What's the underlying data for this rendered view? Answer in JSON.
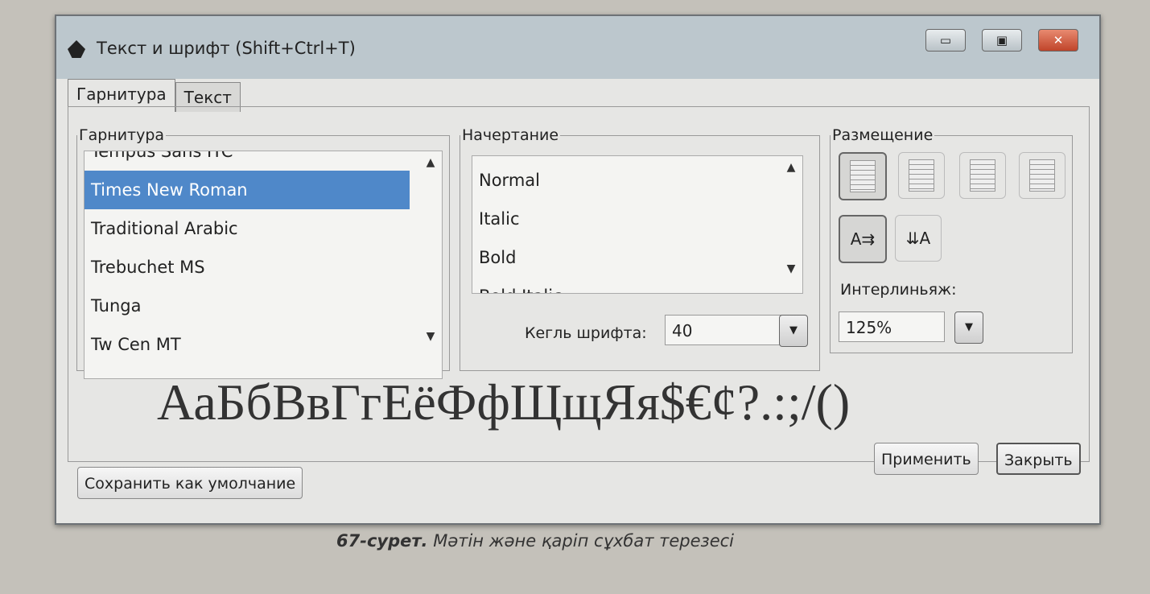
{
  "window": {
    "title": "Текст и шрифт (Shift+Ctrl+T)",
    "controls": [
      "minimize",
      "maximize",
      "close"
    ]
  },
  "tabs": [
    {
      "label": "Гарнитура",
      "active": true
    },
    {
      "label": "Текст",
      "active": false
    }
  ],
  "font_family": {
    "legend": "Гарнитура",
    "items": [
      "Tempus Sans ITC",
      "Times New Roman",
      "Traditional Arabic",
      "Trebuchet MS",
      "Tunga",
      "Tw Cen MT"
    ],
    "selected": "Times New Roman"
  },
  "style": {
    "legend": "Начертание",
    "items": [
      "Normal",
      "Italic",
      "Bold",
      "Bold Italic"
    ]
  },
  "size": {
    "label": "Кегль шрифта:",
    "value": "40"
  },
  "layout": {
    "legend": "Размещение",
    "alignment_icons": [
      "align-left-icon",
      "align-center-icon",
      "align-right-icon",
      "align-justify-icon"
    ],
    "selected_alignment": "align-left",
    "direction_icons": [
      "horizontal-text-icon",
      "vertical-text-icon"
    ],
    "selected_direction": "horizontal",
    "line_spacing_label": "Интерлиньяж:",
    "line_spacing_value": "125%"
  },
  "preview_text": "АаБбВвГгЕёФфЩщЯя$€¢?.:;/()",
  "buttons": {
    "save_default": "Сохранить как умолчание",
    "apply": "Применить",
    "close": "Закрыть"
  },
  "caption": {
    "number": "67-сурет.",
    "text": "Мәтін және қаріп сұхбат терезесі"
  }
}
